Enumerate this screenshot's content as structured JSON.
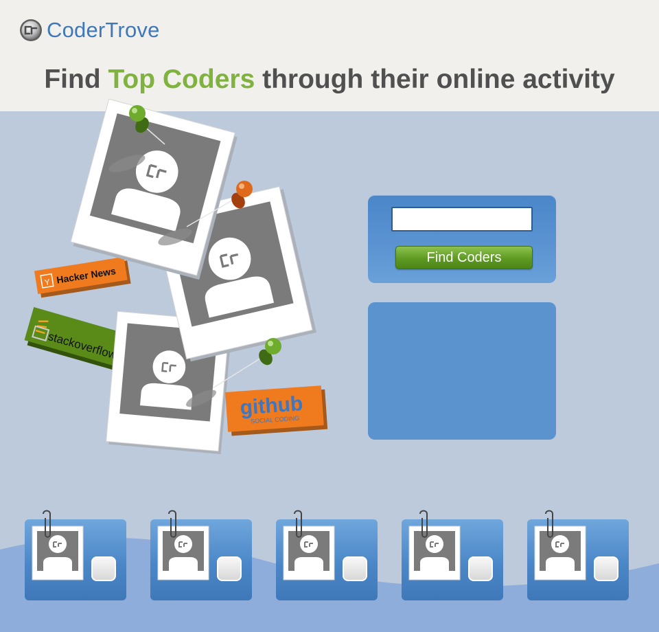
{
  "brand": {
    "logo_icon": "coder-trove-logo-icon",
    "name": "CoderTrove"
  },
  "headline": {
    "prefix": "Find ",
    "accent": "Top Coders",
    "suffix": " through their online activity"
  },
  "collage": {
    "badges": {
      "hacker_news_icon": "Y",
      "hacker_news": "Hacker News",
      "stackoverflow": "stackoverflow",
      "github": "github",
      "github_tagline": "SOCIAL CODING"
    }
  },
  "search": {
    "input_value": "",
    "button_label": "Find Coders"
  },
  "results": {},
  "coder_cards": [
    {
      "id": 1
    },
    {
      "id": 2
    },
    {
      "id": 3
    },
    {
      "id": 4
    },
    {
      "id": 5
    }
  ],
  "colors": {
    "brand_blue": "#3d78b9",
    "accent_green": "#7fb23e",
    "header_bg": "#f2f0ec",
    "page_bg": "#bccadc",
    "orange_badge": "#f07a1e",
    "green_badge": "#5a8a18"
  }
}
